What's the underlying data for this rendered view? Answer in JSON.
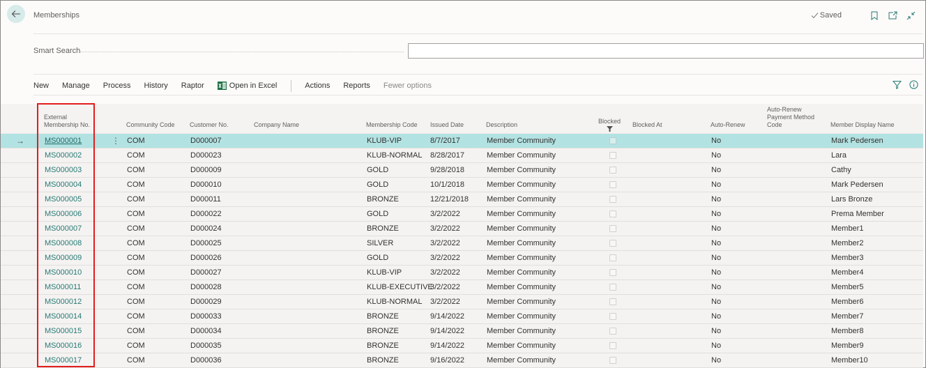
{
  "header": {
    "title": "Memberships",
    "saved_label": "Saved",
    "icons": [
      "back-arrow-icon",
      "checkmark-icon",
      "bookmark-icon",
      "open-new-window-icon",
      "collapse-icon"
    ]
  },
  "smart_search": {
    "label": "Smart Search",
    "value": "",
    "placeholder": ""
  },
  "action_bar": {
    "items": [
      "New",
      "Manage",
      "Process",
      "History",
      "Raptor",
      "Open in Excel",
      "Actions",
      "Reports",
      "Fewer options"
    ],
    "icons": [
      "excel-icon",
      "filter-icon",
      "info-icon"
    ]
  },
  "colors": {
    "accent": "#267a73",
    "selected_row": "#b3e2e2",
    "highlight": "#e31c1c"
  },
  "grid": {
    "columns": {
      "external_no_line1": "External",
      "external_no_line2": "Membership No.",
      "community_code": "Community Code",
      "customer_no": "Customer No.",
      "company_name": "Company Name",
      "membership_code": "Membership Code",
      "issued_date": "Issued Date",
      "description": "Description",
      "blocked": "Blocked",
      "blocked_at": "Blocked At",
      "auto_renew": "Auto-Renew",
      "payment_line1": "Auto-Renew",
      "payment_line2": "Payment Method",
      "payment_line3": "Code",
      "display_name": "Member Display Name"
    },
    "rows": [
      {
        "no": "MS000001",
        "community": "COM",
        "customer": "D000007",
        "company": "",
        "code": "KLUB-VIP",
        "date": "8/7/2017",
        "desc": "Member Community",
        "blocked": false,
        "blocked_at": "",
        "auto": "No",
        "pay": "",
        "name": "Mark Pedersen",
        "selected": true
      },
      {
        "no": "MS000002",
        "community": "COM",
        "customer": "D000023",
        "company": "",
        "code": "KLUB-NORMAL",
        "date": "8/28/2017",
        "desc": "Member Community",
        "blocked": false,
        "blocked_at": "",
        "auto": "No",
        "pay": "",
        "name": "Lara"
      },
      {
        "no": "MS000003",
        "community": "COM",
        "customer": "D000009",
        "company": "",
        "code": "GOLD",
        "date": "9/28/2018",
        "desc": "Member Community",
        "blocked": false,
        "blocked_at": "",
        "auto": "No",
        "pay": "",
        "name": "Cathy"
      },
      {
        "no": "MS000004",
        "community": "COM",
        "customer": "D000010",
        "company": "",
        "code": "GOLD",
        "date": "10/1/2018",
        "desc": "Member Community",
        "blocked": false,
        "blocked_at": "",
        "auto": "No",
        "pay": "",
        "name": "Mark Pedersen"
      },
      {
        "no": "MS000005",
        "community": "COM",
        "customer": "D000011",
        "company": "",
        "code": "BRONZE",
        "date": "12/21/2018",
        "desc": "Member Community",
        "blocked": false,
        "blocked_at": "",
        "auto": "No",
        "pay": "",
        "name": "Lars Bronze"
      },
      {
        "no": "MS000006",
        "community": "COM",
        "customer": "D000022",
        "company": "",
        "code": "GOLD",
        "date": "3/2/2022",
        "desc": "Member Community",
        "blocked": false,
        "blocked_at": "",
        "auto": "No",
        "pay": "",
        "name": "Prema Member"
      },
      {
        "no": "MS000007",
        "community": "COM",
        "customer": "D000024",
        "company": "",
        "code": "BRONZE",
        "date": "3/2/2022",
        "desc": "Member Community",
        "blocked": false,
        "blocked_at": "",
        "auto": "No",
        "pay": "",
        "name": "Member1"
      },
      {
        "no": "MS000008",
        "community": "COM",
        "customer": "D000025",
        "company": "",
        "code": "SILVER",
        "date": "3/2/2022",
        "desc": "Member Community",
        "blocked": false,
        "blocked_at": "",
        "auto": "No",
        "pay": "",
        "name": "Member2"
      },
      {
        "no": "MS000009",
        "community": "COM",
        "customer": "D000026",
        "company": "",
        "code": "GOLD",
        "date": "3/2/2022",
        "desc": "Member Community",
        "blocked": false,
        "blocked_at": "",
        "auto": "No",
        "pay": "",
        "name": "Member3"
      },
      {
        "no": "MS000010",
        "community": "COM",
        "customer": "D000027",
        "company": "",
        "code": "KLUB-VIP",
        "date": "3/2/2022",
        "desc": "Member Community",
        "blocked": false,
        "blocked_at": "",
        "auto": "No",
        "pay": "",
        "name": "Member4"
      },
      {
        "no": "MS000011",
        "community": "COM",
        "customer": "D000028",
        "company": "",
        "code": "KLUB-EXECUTIVE",
        "date": "3/2/2022",
        "desc": "Member Community",
        "blocked": false,
        "blocked_at": "",
        "auto": "No",
        "pay": "",
        "name": "Member5"
      },
      {
        "no": "MS000012",
        "community": "COM",
        "customer": "D000029",
        "company": "",
        "code": "KLUB-NORMAL",
        "date": "3/2/2022",
        "desc": "Member Community",
        "blocked": false,
        "blocked_at": "",
        "auto": "No",
        "pay": "",
        "name": "Member6"
      },
      {
        "no": "MS000014",
        "community": "COM",
        "customer": "D000033",
        "company": "",
        "code": "BRONZE",
        "date": "9/14/2022",
        "desc": "Member Community",
        "blocked": false,
        "blocked_at": "",
        "auto": "No",
        "pay": "",
        "name": "Member7"
      },
      {
        "no": "MS000015",
        "community": "COM",
        "customer": "D000034",
        "company": "",
        "code": "BRONZE",
        "date": "9/14/2022",
        "desc": "Member Community",
        "blocked": false,
        "blocked_at": "",
        "auto": "No",
        "pay": "",
        "name": "Member8"
      },
      {
        "no": "MS000016",
        "community": "COM",
        "customer": "D000035",
        "company": "",
        "code": "BRONZE",
        "date": "9/14/2022",
        "desc": "Member Community",
        "blocked": false,
        "blocked_at": "",
        "auto": "No",
        "pay": "",
        "name": "Member9"
      },
      {
        "no": "MS000017",
        "community": "COM",
        "customer": "D000036",
        "company": "",
        "code": "BRONZE",
        "date": "9/16/2022",
        "desc": "Member Community",
        "blocked": false,
        "blocked_at": "",
        "auto": "No",
        "pay": "",
        "name": "Member10"
      }
    ]
  }
}
